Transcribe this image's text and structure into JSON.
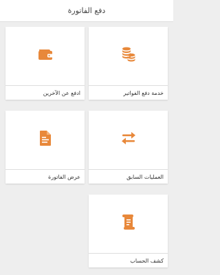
{
  "header": {
    "title": "دفع الفاتورة"
  },
  "tiles": [
    {
      "label": "خدمة دفع الفواتير",
      "icon": "coins-icon"
    },
    {
      "label": "ادفع عن الآخرين",
      "icon": "wallet-icon"
    },
    {
      "label": "العمليات السابق",
      "icon": "transfer-arrows-icon"
    },
    {
      "label": "عرض الفاتورة",
      "icon": "invoice-document-icon"
    },
    {
      "label": "كشف الحساب",
      "icon": "receipt-scroll-icon"
    }
  ],
  "colors": {
    "accent": "#e8883a",
    "background": "#eeeeee",
    "tile": "#ffffff"
  }
}
